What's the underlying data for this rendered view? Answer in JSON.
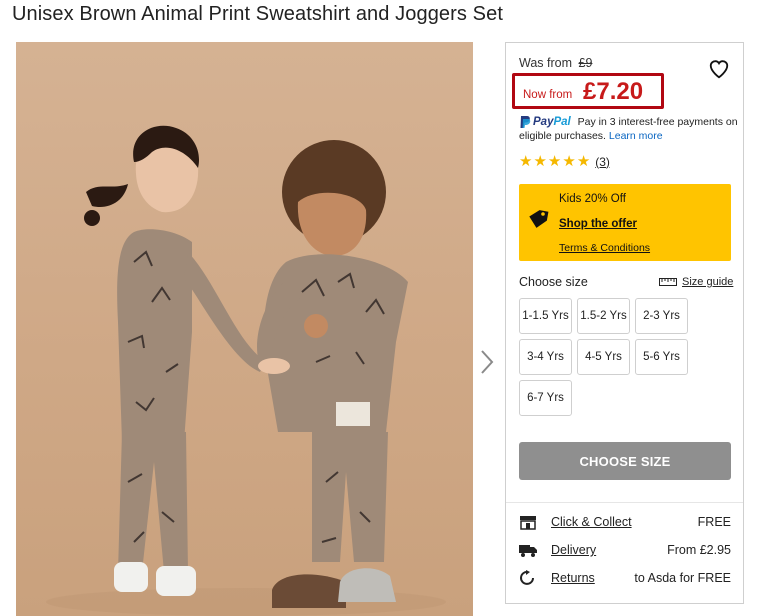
{
  "page": {
    "title": "Unisex Brown Animal Print Sweatshirt and Joggers Set"
  },
  "gallery": {
    "image_alt": "Two children wearing brown dinosaur print sweatshirt and joggers set",
    "next_icon": "chevron-right-icon"
  },
  "pricing": {
    "was_label": "Was from",
    "was_price": "£9",
    "now_label": "Now from",
    "now_price": "£7.20",
    "highlight_color": "#b10712",
    "price_color": "#c71a1a"
  },
  "wishlist": {
    "icon": "heart-icon"
  },
  "paypal": {
    "logo_pay": "Pay",
    "logo_pal": "Pal",
    "text": "Pay in 3 interest-free payments on eligible purchases.",
    "learn_more": "Learn more"
  },
  "rating": {
    "stars": 5,
    "max": 5,
    "count": "(3)",
    "star_color": "#f5b800"
  },
  "offer": {
    "title": "Kids 20% Off",
    "link": "Shop the offer",
    "terms": "Terms & Conditions",
    "background": "#ffc400",
    "icon": "tag-icon"
  },
  "sizes": {
    "label": "Choose size",
    "guide": "Size guide",
    "options": [
      "1-1.5 Yrs",
      "1.5-2 Yrs",
      "2-3 Yrs",
      "3-4 Yrs",
      "4-5 Yrs",
      "5-6 Yrs",
      "6-7 Yrs"
    ],
    "button": "CHOOSE SIZE"
  },
  "delivery": [
    {
      "icon": "store-icon",
      "label": "Click & Collect",
      "value": "FREE"
    },
    {
      "icon": "truck-icon",
      "label": "Delivery",
      "value": "From £2.95"
    },
    {
      "icon": "returns-icon",
      "label": "Returns",
      "value": "to Asda for FREE"
    }
  ]
}
